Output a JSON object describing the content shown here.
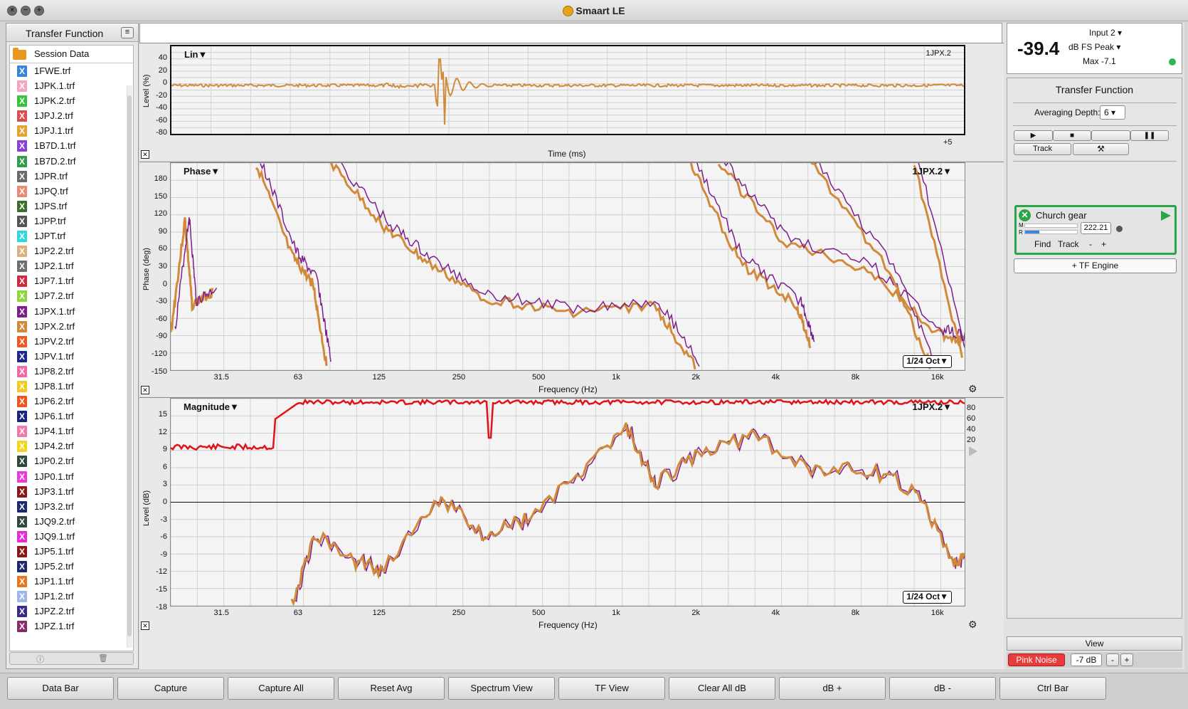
{
  "window": {
    "title": "Smaart LE"
  },
  "left_panel": {
    "title": "Transfer Function",
    "session_label": "Session Data",
    "files": [
      {
        "name": "1FWE.trf",
        "color": "#3b82d8"
      },
      {
        "name": "1JPK.1.trf",
        "color": "#f4a6c0"
      },
      {
        "name": "1JPK.2.trf",
        "color": "#38c23b"
      },
      {
        "name": "1JPJ.2.trf",
        "color": "#d94f4f"
      },
      {
        "name": "1JPJ.1.trf",
        "color": "#e3a335"
      },
      {
        "name": "1B7D.1.trf",
        "color": "#8a3fd8"
      },
      {
        "name": "1B7D.2.trf",
        "color": "#2f9d4a"
      },
      {
        "name": "1JPR.trf",
        "color": "#6a6a6a"
      },
      {
        "name": "1JPQ.trf",
        "color": "#e88a74"
      },
      {
        "name": "1JPS.trf",
        "color": "#3b6f2e"
      },
      {
        "name": "1JPP.trf",
        "color": "#555555"
      },
      {
        "name": "1JPT.trf",
        "color": "#2ed6e0"
      },
      {
        "name": "1JP2.2.trf",
        "color": "#d9b07f"
      },
      {
        "name": "1JP2.1.trf",
        "color": "#6e6e6e"
      },
      {
        "name": "1JP7.1.trf",
        "color": "#d02a3c"
      },
      {
        "name": "1JP7.2.trf",
        "color": "#8bd63a"
      },
      {
        "name": "1JPX.1.trf",
        "color": "#7d1f8c"
      },
      {
        "name": "1JPX.2.trf",
        "color": "#d08a3a"
      },
      {
        "name": "1JPV.2.trf",
        "color": "#f05a22"
      },
      {
        "name": "1JPV.1.trf",
        "color": "#1a2a8a"
      },
      {
        "name": "1JP8.2.trf",
        "color": "#f06aa8"
      },
      {
        "name": "1JP8.1.trf",
        "color": "#f5c81e"
      },
      {
        "name": "1JP6.2.trf",
        "color": "#f0541e"
      },
      {
        "name": "1JP6.1.trf",
        "color": "#1a237e"
      },
      {
        "name": "1JP4.1.trf",
        "color": "#f07aa8"
      },
      {
        "name": "1JP4.2.trf",
        "color": "#f5d41e"
      },
      {
        "name": "1JP0.2.trf",
        "color": "#2e4a3a"
      },
      {
        "name": "1JP0.1.trf",
        "color": "#e83ad6"
      },
      {
        "name": "1JP3.1.trf",
        "color": "#8a1a1a"
      },
      {
        "name": "1JP3.2.trf",
        "color": "#1a2a6a"
      },
      {
        "name": "1JQ9.2.trf",
        "color": "#2f4a3a"
      },
      {
        "name": "1JQ9.1.trf",
        "color": "#e82ad6"
      },
      {
        "name": "1JP5.1.trf",
        "color": "#8a1a1a"
      },
      {
        "name": "1JP5.2.trf",
        "color": "#1a2a6a"
      },
      {
        "name": "1JP1.1.trf",
        "color": "#e8761e"
      },
      {
        "name": "1JP1.2.trf",
        "color": "#9ab8e8"
      },
      {
        "name": "1JPZ.2.trf",
        "color": "#3a2a8a"
      },
      {
        "name": "1JPZ.1.trf",
        "color": "#8a2a6a"
      }
    ]
  },
  "plots": {
    "impulse": {
      "mode_label": "Lin▼",
      "trace_label": "1JPX.2",
      "ylabel": "Level (%)",
      "xlabel": "Time (ms)",
      "yticks": [
        "40",
        "20",
        "0",
        "-20",
        "-40",
        "-60",
        "-80"
      ],
      "xtick": "+5"
    },
    "phase": {
      "mode_label": "Phase▼",
      "trace_label": "1JPX.2▼",
      "ylabel": "Phase (deg)",
      "xlabel": "Frequency (Hz)",
      "yticks": [
        "180",
        "150",
        "120",
        "90",
        "60",
        "30",
        "0",
        "-30",
        "-60",
        "-90",
        "-120",
        "-150"
      ],
      "smoothing": "1/24 Oct▼"
    },
    "magnitude": {
      "mode_label": "Magnitude▼",
      "trace_label": "1JPX.2▼",
      "ylabel": "Level (dB)",
      "xlabel": "Frequency (Hz)",
      "yticks": [
        "15",
        "12",
        "9",
        "6",
        "3",
        "0",
        "-3",
        "-6",
        "-9",
        "-12",
        "-15",
        "-18"
      ],
      "coh_ticks": [
        "80",
        "60",
        "40",
        "20"
      ],
      "smoothing": "1/24 Oct▼"
    },
    "freq_ticks": [
      "31.5",
      "63",
      "125",
      "250",
      "500",
      "1k",
      "2k",
      "4k",
      "8k",
      "16k"
    ]
  },
  "right_panel": {
    "level_value": "-39.4",
    "input": "Input 2",
    "metric": "dB FS Peak",
    "max": "Max -7.1",
    "section_title": "Transfer Function",
    "averaging_label": "Averaging Depth:",
    "averaging_value": "6",
    "track_label": "Track",
    "engine": {
      "name": "Church gear",
      "delay": "222.21",
      "m_label": "M",
      "r_label": "R",
      "find": "Find",
      "track": "Track",
      "minus": "-",
      "plus": "+"
    },
    "add_engine": "+ TF Engine",
    "view_label": "View",
    "pink_noise": "Pink Noise",
    "noise_level": "-7 dB",
    "minus": "-",
    "plus": "+"
  },
  "bottom_buttons": [
    "Data Bar",
    "Capture",
    "Capture All",
    "Reset Avg",
    "Spectrum View",
    "TF View",
    "Clear All dB",
    "dB +",
    "dB -",
    "Ctrl Bar"
  ],
  "colors": {
    "trace_orange": "#d08a3a",
    "trace_purple": "#7d1f8c",
    "coherence_red": "#e0121a",
    "engine_green": "#2aa548",
    "pink_noise": "#e83b3b"
  }
}
